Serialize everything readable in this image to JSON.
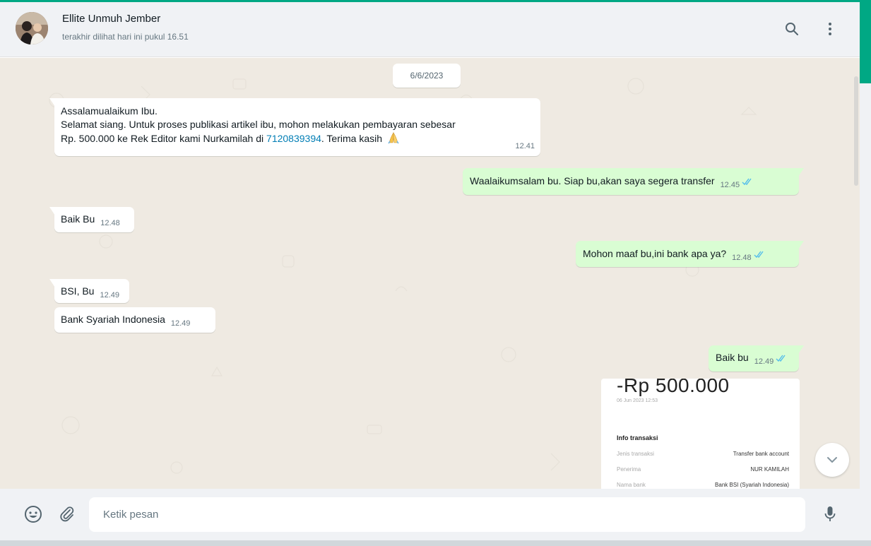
{
  "header": {
    "contact_name": "Ellite Unmuh Jember",
    "status": "terakhir dilihat hari ini pukul 16.51",
    "icons": [
      "search-icon",
      "menu-dots-icon"
    ]
  },
  "chat": {
    "date": "6/6/2023",
    "messages": [
      {
        "direction": "in",
        "lines": [
          "Assalamualaikum Ibu.",
          "Selamat siang. Untuk proses publikasi artikel ibu, mohon melakukan pembayaran sebesar"
        ],
        "line3_pre": "Rp. 500.000 ke Rek Editor kami Nurkamilah di ",
        "link": "7120839394",
        "line3_post": ". Terima kasih",
        "emoji": "folded-hands-emoji",
        "time": "12.41"
      },
      {
        "direction": "out",
        "text": "Waalaikumsalam bu. Siap bu,akan saya segera transfer",
        "time": "12.45",
        "status": "read"
      },
      {
        "direction": "in",
        "text": "Baik Bu",
        "time": "12.48"
      },
      {
        "direction": "out",
        "text": "Mohon maaf bu,ini bank apa ya?",
        "time": "12.48",
        "status": "read"
      },
      {
        "direction": "in",
        "text": "BSI, Bu",
        "time": "12.49"
      },
      {
        "direction": "in",
        "text": "Bank Syariah Indonesia",
        "time": "12.49"
      },
      {
        "direction": "out",
        "text": "Baik bu",
        "time": "12.49",
        "status": "read"
      }
    ],
    "receipt": {
      "amount": "-Rp 500.000",
      "datetime": "06 Jun 2023 12:53",
      "section_title": "Info transaksi",
      "rows": [
        {
          "key": "Jenis transaksi",
          "value": "Transfer bank account"
        },
        {
          "key": "Penerima",
          "value": "NUR KAMILAH"
        },
        {
          "key": "Nama bank",
          "value": "Bank BSI (Syariah Indonesia)"
        }
      ]
    }
  },
  "footer": {
    "placeholder": "Ketik pesan",
    "icons": [
      "emoji-icon",
      "attach-icon",
      "mic-icon"
    ]
  },
  "colors": {
    "accent": "#00a884",
    "outgoing_bubble": "#d9fdd3",
    "incoming_bubble": "#ffffff",
    "chat_bg": "#efeae2",
    "read_ticks": "#53bdeb"
  }
}
